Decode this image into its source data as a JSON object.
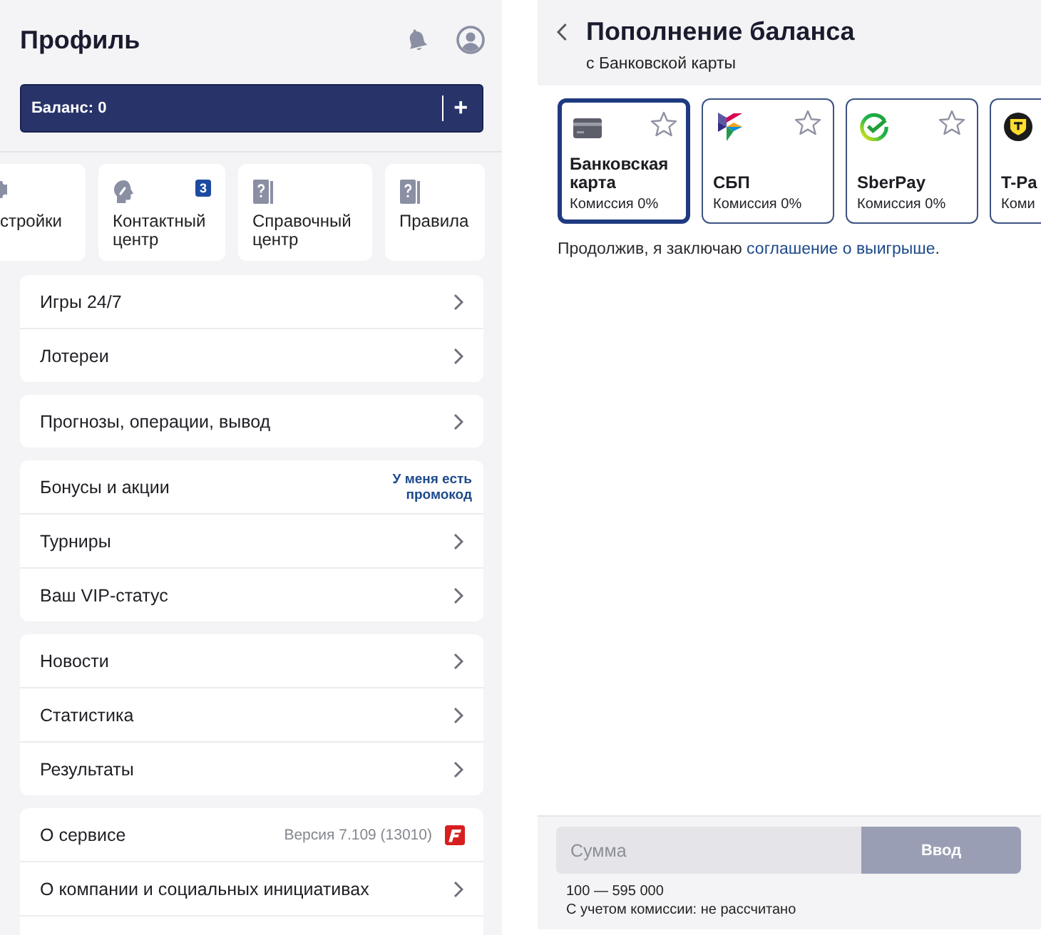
{
  "profile": {
    "title": "Профиль",
    "balance": {
      "label": "Баланс: 0",
      "action": "+"
    },
    "shortcuts": [
      {
        "kind": "gear",
        "label": "стройки"
      },
      {
        "kind": "head",
        "label": "Контактный центр",
        "badge": "3"
      },
      {
        "kind": "book",
        "label": "Справочный центр"
      },
      {
        "kind": "book",
        "label": "Правила"
      }
    ],
    "menu_groups": [
      {
        "items": [
          {
            "kind": "nav",
            "label": "Игры 24/7"
          },
          {
            "kind": "nav",
            "label": "Лотереи"
          }
        ]
      },
      {
        "items": [
          {
            "kind": "nav",
            "label": "Прогнозы, операции, вывод"
          }
        ]
      },
      {
        "items": [
          {
            "kind": "promo",
            "label": "Бонусы и акции",
            "action": "У меня есть промокод"
          },
          {
            "kind": "nav",
            "label": "Турниры"
          },
          {
            "kind": "nav",
            "label": "Ваш VIP-статус"
          }
        ]
      },
      {
        "items": [
          {
            "kind": "nav",
            "label": "Новости"
          },
          {
            "kind": "nav",
            "label": "Статистика"
          },
          {
            "kind": "nav",
            "label": "Результаты"
          }
        ]
      },
      {
        "items": [
          {
            "kind": "about",
            "label": "О сервисе",
            "version": "Версия 7.109 (13010)"
          },
          {
            "kind": "nav",
            "label": "О компании и социальных инициативах"
          }
        ]
      }
    ]
  },
  "top_up": {
    "title": "Пополнение баланса",
    "subtitle": "с Банковской карты",
    "methods": [
      {
        "kind": "card",
        "name": "Банковская карта",
        "fee": "Комиссия 0%",
        "selected": true,
        "favorite": false
      },
      {
        "kind": "sbp",
        "name": "СБП",
        "fee": "Комиссия 0%",
        "selected": false,
        "favorite": false
      },
      {
        "kind": "sberpay",
        "name": "SberPay",
        "fee": "Комиссия 0%",
        "selected": false,
        "favorite": false
      },
      {
        "kind": "tpay",
        "name": "T-Pa",
        "fee": "Коми",
        "selected": false
      }
    ],
    "agreement": {
      "text": "Продолжив, я заключаю",
      "link": "соглашение о выигрыше",
      "end": "."
    },
    "amount": {
      "placeholder": "Сумма"
    },
    "submit": "Ввод",
    "range": "100 — 595 000",
    "commission": "С учетом комиссии: не рассчитано"
  }
}
